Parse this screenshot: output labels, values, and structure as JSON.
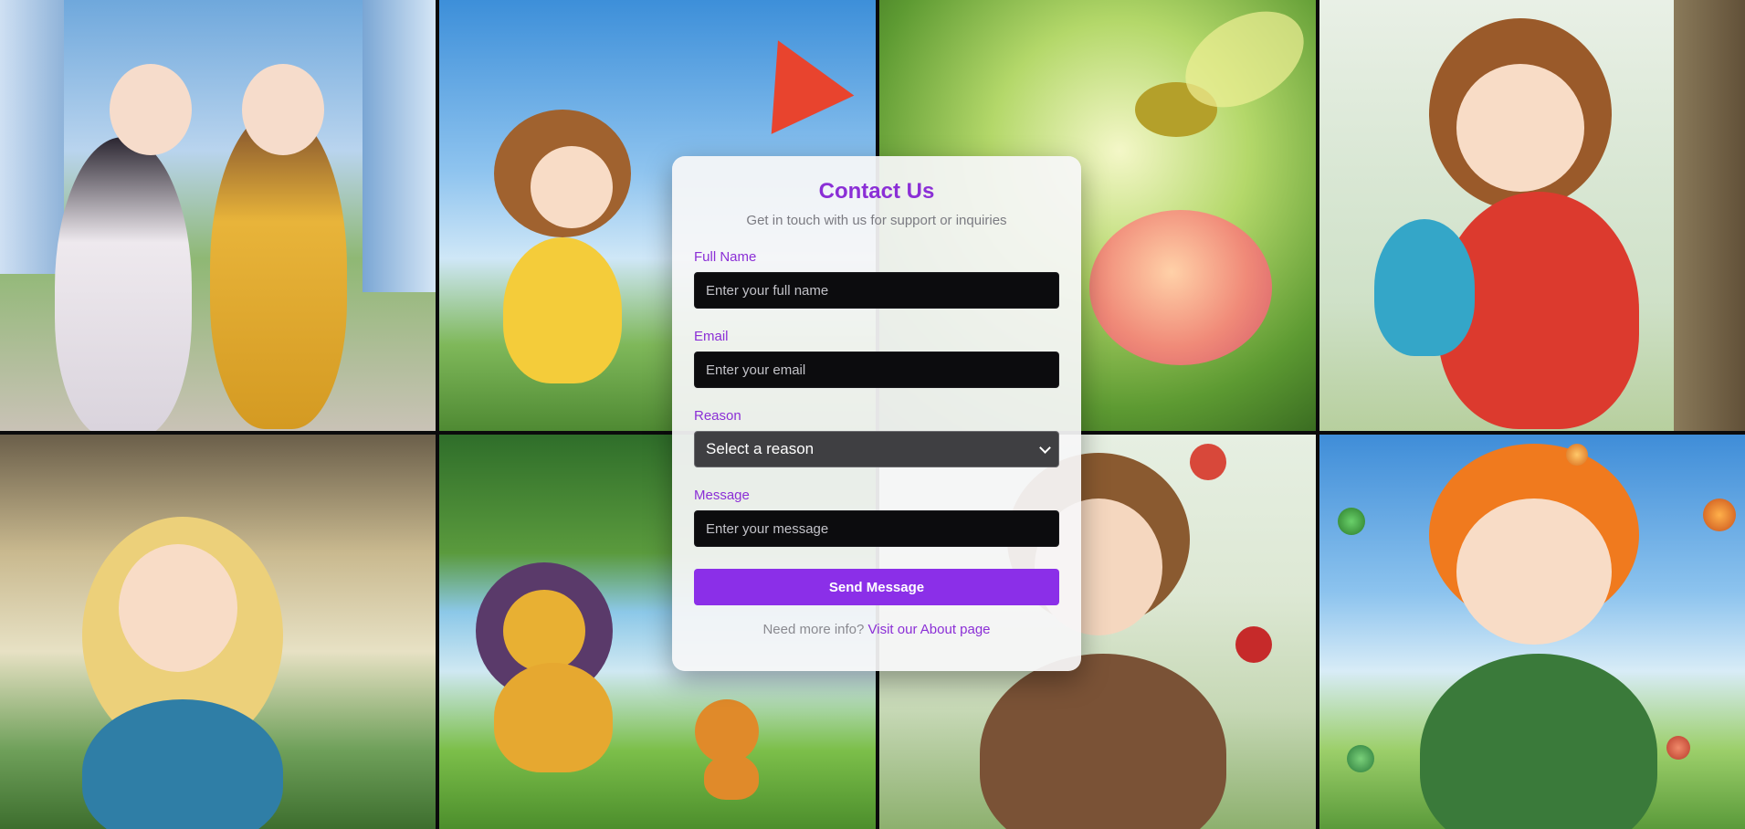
{
  "gallery": {
    "images": [
      {
        "name": "two-girls-city-street"
      },
      {
        "name": "girl-yellow-dress-kite"
      },
      {
        "name": "bee-and-rose"
      },
      {
        "name": "curly-girl-blue-bunny"
      },
      {
        "name": "blonde-girl-window"
      },
      {
        "name": "lion-and-cub"
      },
      {
        "name": "boy-with-roses"
      },
      {
        "name": "orange-haired-boy-bubbles"
      }
    ]
  },
  "contact": {
    "title": "Contact Us",
    "subtitle": "Get in touch with us for support or inquiries",
    "fields": {
      "full_name": {
        "label": "Full Name",
        "placeholder": "Enter your full name",
        "value": ""
      },
      "email": {
        "label": "Email",
        "placeholder": "Enter your email",
        "value": ""
      },
      "reason": {
        "label": "Reason",
        "selected": "Select a reason"
      },
      "message": {
        "label": "Message",
        "placeholder": "Enter your message",
        "value": ""
      }
    },
    "submit_label": "Send Message",
    "footer": {
      "text": "Need more info?",
      "link_text": "Visit our About page"
    }
  },
  "colors": {
    "accent": "#8b2fd6",
    "button": "#8b2fe8",
    "input_bg": "#0c0c0e",
    "select_bg": "#3f3f42"
  }
}
